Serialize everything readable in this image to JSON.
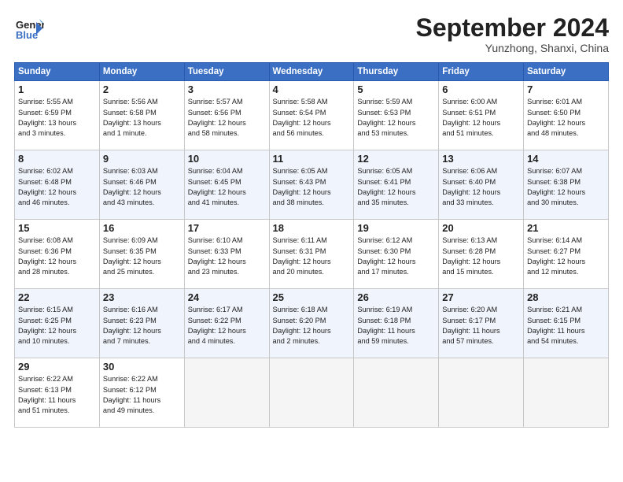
{
  "header": {
    "logo_line1": "General",
    "logo_line2": "Blue",
    "month": "September 2024",
    "location": "Yunzhong, Shanxi, China"
  },
  "columns": [
    "Sunday",
    "Monday",
    "Tuesday",
    "Wednesday",
    "Thursday",
    "Friday",
    "Saturday"
  ],
  "weeks": [
    [
      {
        "day": "1",
        "text": "Sunrise: 5:55 AM\nSunset: 6:59 PM\nDaylight: 13 hours\nand 3 minutes."
      },
      {
        "day": "2",
        "text": "Sunrise: 5:56 AM\nSunset: 6:58 PM\nDaylight: 13 hours\nand 1 minute."
      },
      {
        "day": "3",
        "text": "Sunrise: 5:57 AM\nSunset: 6:56 PM\nDaylight: 12 hours\nand 58 minutes."
      },
      {
        "day": "4",
        "text": "Sunrise: 5:58 AM\nSunset: 6:54 PM\nDaylight: 12 hours\nand 56 minutes."
      },
      {
        "day": "5",
        "text": "Sunrise: 5:59 AM\nSunset: 6:53 PM\nDaylight: 12 hours\nand 53 minutes."
      },
      {
        "day": "6",
        "text": "Sunrise: 6:00 AM\nSunset: 6:51 PM\nDaylight: 12 hours\nand 51 minutes."
      },
      {
        "day": "7",
        "text": "Sunrise: 6:01 AM\nSunset: 6:50 PM\nDaylight: 12 hours\nand 48 minutes."
      }
    ],
    [
      {
        "day": "8",
        "text": "Sunrise: 6:02 AM\nSunset: 6:48 PM\nDaylight: 12 hours\nand 46 minutes."
      },
      {
        "day": "9",
        "text": "Sunrise: 6:03 AM\nSunset: 6:46 PM\nDaylight: 12 hours\nand 43 minutes."
      },
      {
        "day": "10",
        "text": "Sunrise: 6:04 AM\nSunset: 6:45 PM\nDaylight: 12 hours\nand 41 minutes."
      },
      {
        "day": "11",
        "text": "Sunrise: 6:05 AM\nSunset: 6:43 PM\nDaylight: 12 hours\nand 38 minutes."
      },
      {
        "day": "12",
        "text": "Sunrise: 6:05 AM\nSunset: 6:41 PM\nDaylight: 12 hours\nand 35 minutes."
      },
      {
        "day": "13",
        "text": "Sunrise: 6:06 AM\nSunset: 6:40 PM\nDaylight: 12 hours\nand 33 minutes."
      },
      {
        "day": "14",
        "text": "Sunrise: 6:07 AM\nSunset: 6:38 PM\nDaylight: 12 hours\nand 30 minutes."
      }
    ],
    [
      {
        "day": "15",
        "text": "Sunrise: 6:08 AM\nSunset: 6:36 PM\nDaylight: 12 hours\nand 28 minutes."
      },
      {
        "day": "16",
        "text": "Sunrise: 6:09 AM\nSunset: 6:35 PM\nDaylight: 12 hours\nand 25 minutes."
      },
      {
        "day": "17",
        "text": "Sunrise: 6:10 AM\nSunset: 6:33 PM\nDaylight: 12 hours\nand 23 minutes."
      },
      {
        "day": "18",
        "text": "Sunrise: 6:11 AM\nSunset: 6:31 PM\nDaylight: 12 hours\nand 20 minutes."
      },
      {
        "day": "19",
        "text": "Sunrise: 6:12 AM\nSunset: 6:30 PM\nDaylight: 12 hours\nand 17 minutes."
      },
      {
        "day": "20",
        "text": "Sunrise: 6:13 AM\nSunset: 6:28 PM\nDaylight: 12 hours\nand 15 minutes."
      },
      {
        "day": "21",
        "text": "Sunrise: 6:14 AM\nSunset: 6:27 PM\nDaylight: 12 hours\nand 12 minutes."
      }
    ],
    [
      {
        "day": "22",
        "text": "Sunrise: 6:15 AM\nSunset: 6:25 PM\nDaylight: 12 hours\nand 10 minutes."
      },
      {
        "day": "23",
        "text": "Sunrise: 6:16 AM\nSunset: 6:23 PM\nDaylight: 12 hours\nand 7 minutes."
      },
      {
        "day": "24",
        "text": "Sunrise: 6:17 AM\nSunset: 6:22 PM\nDaylight: 12 hours\nand 4 minutes."
      },
      {
        "day": "25",
        "text": "Sunrise: 6:18 AM\nSunset: 6:20 PM\nDaylight: 12 hours\nand 2 minutes."
      },
      {
        "day": "26",
        "text": "Sunrise: 6:19 AM\nSunset: 6:18 PM\nDaylight: 11 hours\nand 59 minutes."
      },
      {
        "day": "27",
        "text": "Sunrise: 6:20 AM\nSunset: 6:17 PM\nDaylight: 11 hours\nand 57 minutes."
      },
      {
        "day": "28",
        "text": "Sunrise: 6:21 AM\nSunset: 6:15 PM\nDaylight: 11 hours\nand 54 minutes."
      }
    ],
    [
      {
        "day": "29",
        "text": "Sunrise: 6:22 AM\nSunset: 6:13 PM\nDaylight: 11 hours\nand 51 minutes."
      },
      {
        "day": "30",
        "text": "Sunrise: 6:22 AM\nSunset: 6:12 PM\nDaylight: 11 hours\nand 49 minutes."
      },
      {
        "day": "",
        "text": ""
      },
      {
        "day": "",
        "text": ""
      },
      {
        "day": "",
        "text": ""
      },
      {
        "day": "",
        "text": ""
      },
      {
        "day": "",
        "text": ""
      }
    ]
  ]
}
